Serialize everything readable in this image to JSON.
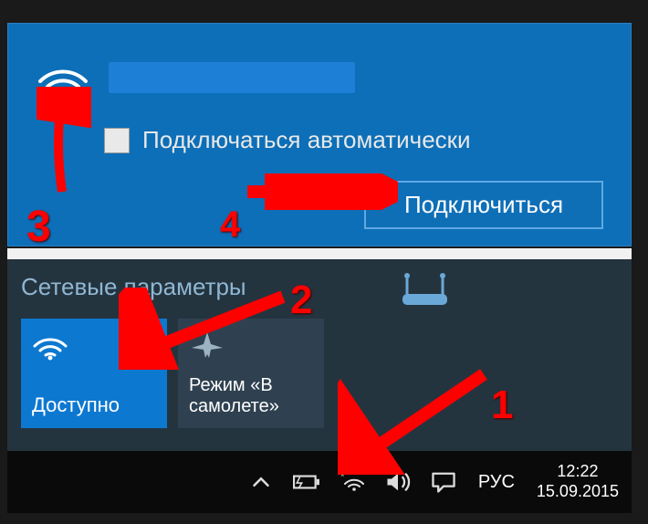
{
  "network_flyout": {
    "auto_connect_label": "Подключаться автоматически",
    "connect_button": "Подключиться"
  },
  "network_settings": {
    "header": "Сетевые параметры",
    "tile_wifi_label": "Доступно",
    "tile_airplane_label": "Режим «В самолете»"
  },
  "taskbar": {
    "language": "РУС",
    "time": "12:22",
    "date": "15.09.2015"
  },
  "annotations": {
    "step1": "1",
    "step2": "2",
    "step3": "3",
    "step4": "4"
  }
}
